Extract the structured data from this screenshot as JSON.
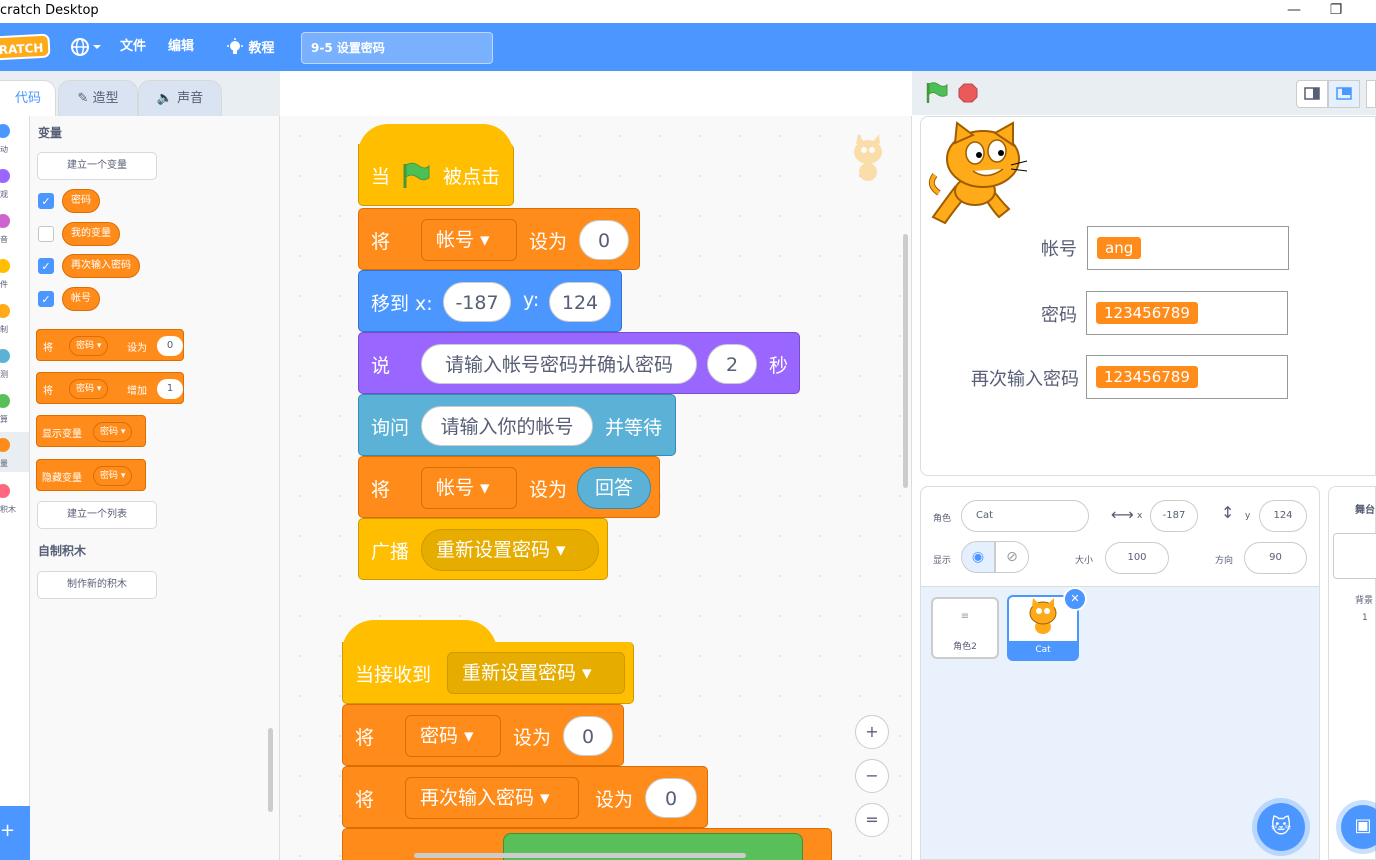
{
  "window": {
    "title": "cratch Desktop",
    "minimize": "—",
    "restore": "❐"
  },
  "menu": {
    "logo": "RATCH",
    "file": "文件",
    "edit": "编辑",
    "tutorials": "教程",
    "project_title": "9-5 设置密码"
  },
  "tabs": {
    "code": "代码",
    "costumes": "造型",
    "sounds": "声音"
  },
  "categories": [
    {
      "label": "动",
      "color": "#4c97ff"
    },
    {
      "label": "观",
      "color": "#9966ff"
    },
    {
      "label": "音",
      "color": "#cf63cf"
    },
    {
      "label": "件",
      "color": "#ffbf00"
    },
    {
      "label": "制",
      "color": "#ffab19"
    },
    {
      "label": "测",
      "color": "#5cb1d6"
    },
    {
      "label": "算",
      "color": "#59c059"
    },
    {
      "label": "量",
      "color": "#ff8c1a"
    },
    {
      "label": "积木",
      "color": "#ff6680"
    }
  ],
  "palette": {
    "variables_heading": "变量",
    "make_variable": "建立一个变量",
    "variables": [
      {
        "name": "密码",
        "checked": true
      },
      {
        "name": "我的变量",
        "checked": false
      },
      {
        "name": "再次输入密码",
        "checked": true
      },
      {
        "name": "帐号",
        "checked": true
      }
    ],
    "set_block": {
      "a": "将",
      "var": "密码",
      "b": "设为",
      "val": "0"
    },
    "change_block": {
      "a": "将",
      "var": "密码",
      "b": "增加",
      "val": "1"
    },
    "show_block": {
      "a": "显示变量",
      "var": "密码"
    },
    "hide_block": {
      "a": "隐藏变量",
      "var": "密码"
    },
    "make_list": "建立一个列表",
    "my_blocks_heading": "自制积木",
    "make_block": "制作新的积木"
  },
  "script": {
    "hat1": {
      "a": "当",
      "b": "被点击"
    },
    "set1": {
      "a": "将",
      "var": "帐号",
      "b": "设为",
      "val": "0"
    },
    "goto": {
      "a": "移到 x:",
      "x": "-187",
      "b": "y:",
      "y": "124"
    },
    "say": {
      "a": "说",
      "msg": "请输入帐号密码并确认密码",
      "secs": "2",
      "b": "秒"
    },
    "ask": {
      "a": "询问",
      "msg": "请输入你的帐号",
      "b": "并等待"
    },
    "set2": {
      "a": "将",
      "var": "帐号",
      "b": "设为",
      "val": "回答"
    },
    "broadcast": {
      "a": "广播",
      "msg": "重新设置密码"
    },
    "hat2": {
      "a": "当接收到",
      "msg": "重新设置密码"
    },
    "set3": {
      "a": "将",
      "var": "密码",
      "b": "设为",
      "val": "0"
    },
    "set4": {
      "a": "将",
      "var": "再次输入密码",
      "b": "设为",
      "val": "0"
    },
    "zoom_in": "+",
    "zoom_out": "−",
    "zoom_reset": "="
  },
  "stage": {
    "monitors": [
      {
        "label": "帐号",
        "value": "ang"
      },
      {
        "label": "密码",
        "value": "123456789"
      },
      {
        "label": "再次输入密码",
        "value": "123456789"
      }
    ]
  },
  "sprite_info": {
    "sprite_label": "角色",
    "sprite_name": "Cat",
    "x_label": "x",
    "x": "-187",
    "y_label": "y",
    "y": "124",
    "show_label": "显示",
    "size_label": "大小",
    "size": "100",
    "direction_label": "方向",
    "direction": "90"
  },
  "sprites": [
    {
      "name": "角色2",
      "selected": false
    },
    {
      "name": "Cat",
      "selected": true
    }
  ],
  "backdrop": {
    "label": "舞台",
    "bg_label": "背景",
    "count": "1"
  }
}
